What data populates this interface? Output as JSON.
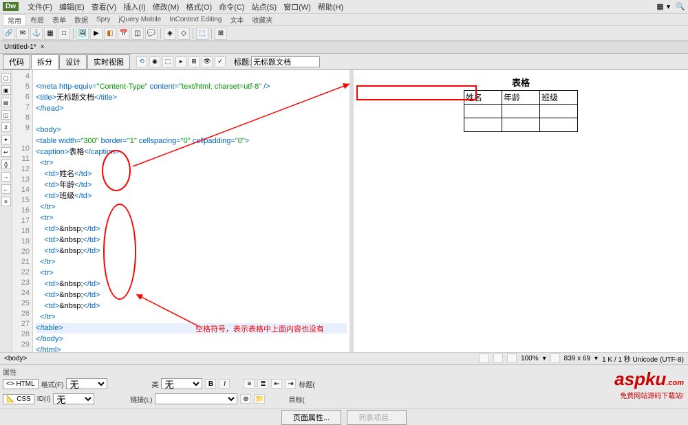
{
  "logo": "Dw",
  "menu": [
    "文件(F)",
    "编辑(E)",
    "查看(V)",
    "插入(I)",
    "修改(M)",
    "格式(O)",
    "命令(C)",
    "站点(S)",
    "窗口(W)",
    "帮助(H)"
  ],
  "tabbar": [
    "常用",
    "布局",
    "表单",
    "数据",
    "Spry",
    "jQuery Mobile",
    "InContext Editing",
    "文本",
    "收藏夹"
  ],
  "doctab": {
    "name": "Untitled-1*",
    "close": "×"
  },
  "view": {
    "buttons": [
      "代码",
      "拆分",
      "设计",
      "实时视图"
    ],
    "title_label": "标题:",
    "title_value": "无标题文档"
  },
  "lines": [
    "4",
    "5",
    "6",
    "7",
    "8",
    "9",
    "",
    "10",
    "11",
    "12",
    "13",
    "14",
    "15",
    "16",
    "17",
    "18",
    "19",
    "20",
    "21",
    "22",
    "23",
    "24",
    "25",
    "26",
    "27",
    "28",
    "29"
  ],
  "code": {
    "l4a": "<meta http-equiv=",
    "l4b": "\"Content-Type\"",
    "l4c": " content=",
    "l4d": "\"text/html; charset=utf-8\"",
    "l4e": " />",
    "l5a": "<title>",
    "l5b": "无标题文档",
    "l5c": "</title>",
    "l6": "</head>",
    "l8": "<body>",
    "l9a": "<table width=",
    "l9b": "\"300\"",
    "l9c": " border=",
    "l9d": "\"1\"",
    "l9e": " cellspacing=",
    "l9f": "\"0\"",
    "l9g": " cellpadding=",
    "l9h": "\"0\"",
    "l9i": ">",
    "l10a": "<caption>",
    "l10b": "表格",
    "l10c": "</caption>",
    "l11": "  <tr>",
    "l12a": "    <td>",
    "l12b": "姓名",
    "l12c": "</td>",
    "l13a": "    <td>",
    "l13b": "年龄",
    "l13c": "</td>",
    "l14a": "    <td>",
    "l14b": "班级",
    "l14c": "</td>",
    "l15": "  </tr>",
    "l16": "  <tr>",
    "l17a": "    <td>",
    "l17b": "&nbsp;",
    "l17c": "</td>",
    "l18a": "    <td>",
    "l18b": "&nbsp;",
    "l18c": "</td>",
    "l19a": "    <td>",
    "l19b": "&nbsp;",
    "l19c": "</td>",
    "l20": "  </tr>",
    "l21": "  <tr>",
    "l22a": "    <td>",
    "l22b": "&nbsp;",
    "l22c": "</td>",
    "l23a": "    <td>",
    "l23b": "&nbsp;",
    "l23c": "</td>",
    "l24a": "    <td>",
    "l24b": "&nbsp;",
    "l24c": "</td>",
    "l25": "  </tr>",
    "l26": "</table>",
    "l27": "</body>",
    "l28": "</html>"
  },
  "preview": {
    "caption": "表格",
    "headers": [
      "姓名",
      "年龄",
      "班级"
    ]
  },
  "annotation": "空格符号，表示表格中上面内容也没有",
  "breadcrumb": "<body>",
  "status": {
    "zoom": "100%",
    "size": "839 x 69",
    "info": "1 K / 1 秒 Unicode (UTF-8)"
  },
  "props": {
    "title": "属性",
    "html": "<> HTML",
    "css": "CSS",
    "format_label": "格式(F)",
    "format_val": "无",
    "id_label": "ID(I)",
    "id_val": "无",
    "class_label": "类",
    "class_val": "无",
    "link_label": "链接(L)",
    "title2": "标题(",
    "target": "目标("
  },
  "footer": {
    "page_props": "页面属性...",
    "list_items": "列表项目..."
  },
  "watermark": {
    "main": "aspku",
    "com": ".com",
    "sub": "免费网站源码下载站!"
  },
  "icons": {
    "search": "🔍",
    "dropdown": "▾",
    "gear": "⚙",
    "layout": "▦"
  }
}
